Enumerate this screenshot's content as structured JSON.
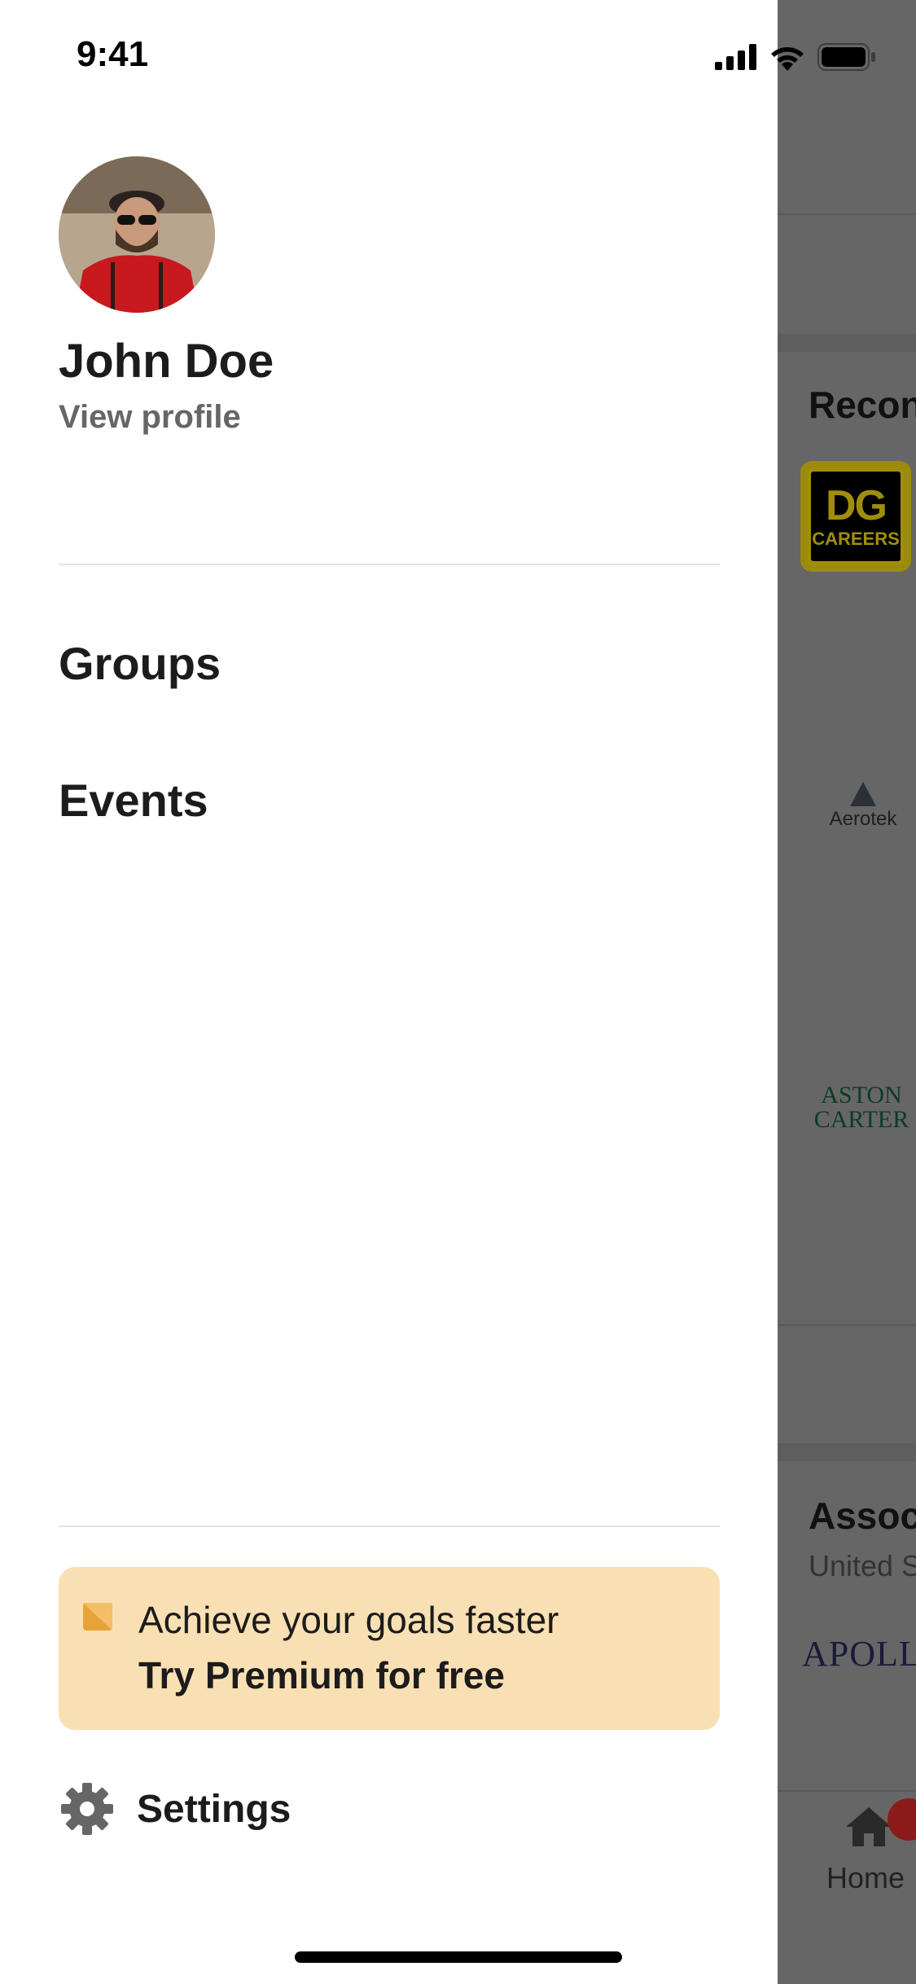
{
  "status_bar": {
    "time": "9:41"
  },
  "drawer": {
    "profile": {
      "name": "John Doe",
      "link_label": "View profile"
    },
    "nav_items": [
      {
        "label": "Groups"
      },
      {
        "label": "Events"
      }
    ],
    "premium": {
      "line1": "Achieve your goals faster",
      "line2": "Try Premium for free",
      "accent_color": "#e8a23a",
      "background_color": "#f9e0b4"
    },
    "settings": {
      "label": "Settings",
      "icon": "gear-icon"
    }
  },
  "background_app": {
    "section1_heading": "Recon",
    "logos": {
      "dg": {
        "line1": "DG",
        "line2": "CAREERS"
      },
      "aerotek": "Aerotek",
      "aston_line1": "ASTON",
      "aston_line2": "CARTER",
      "apollo": "APOLLO"
    },
    "section2_heading": "Assoc",
    "section2_sub": "United S",
    "tab_label": "Home",
    "overlay_color": "#666666"
  }
}
